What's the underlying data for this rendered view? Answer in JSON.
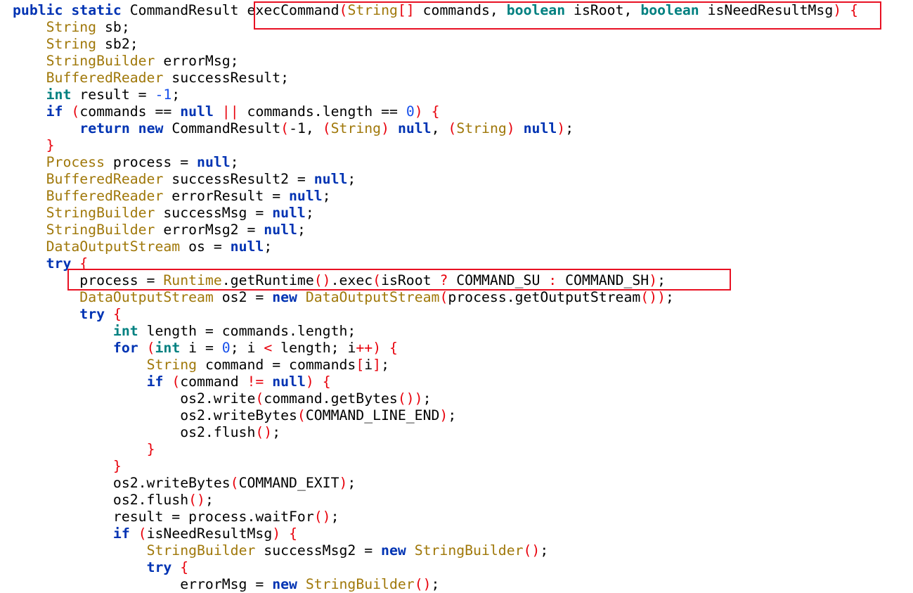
{
  "colors": {
    "background": "#ffffff",
    "keyword": "#0033b3",
    "keyword_alt": "#008080",
    "type": "#a0780a",
    "number": "#1750eb",
    "punctuation": "#e8000b",
    "plain": "#000000",
    "highlight_box": "#e81123"
  },
  "highlights": [
    {
      "name": "highlight-box-method-signature",
      "target": "line 1"
    },
    {
      "name": "highlight-box-runtime-exec",
      "target": "line 17"
    }
  ],
  "code_lines": [
    {
      "indent": "",
      "tokens": [
        [
          "kw",
          "public"
        ],
        [
          "plain",
          " "
        ],
        [
          "kw",
          "static"
        ],
        [
          "plain",
          " CommandResult "
        ],
        [
          "plain",
          "execCommand"
        ],
        [
          "punc",
          "("
        ],
        [
          "type",
          "String"
        ],
        [
          "punc",
          "[]"
        ],
        [
          "plain",
          " commands, "
        ],
        [
          "kw2",
          "boolean"
        ],
        [
          "plain",
          " isRoot, "
        ],
        [
          "kw2",
          "boolean"
        ],
        [
          "plain",
          " isNeedResultMsg"
        ],
        [
          "punc",
          ")"
        ],
        [
          "plain",
          " "
        ],
        [
          "punc",
          "{"
        ]
      ]
    },
    {
      "indent": "    ",
      "tokens": [
        [
          "type",
          "String"
        ],
        [
          "plain",
          " sb;"
        ]
      ]
    },
    {
      "indent": "    ",
      "tokens": [
        [
          "type",
          "String"
        ],
        [
          "plain",
          " sb2;"
        ]
      ]
    },
    {
      "indent": "    ",
      "tokens": [
        [
          "type",
          "StringBuilder"
        ],
        [
          "plain",
          " errorMsg;"
        ]
      ]
    },
    {
      "indent": "    ",
      "tokens": [
        [
          "type",
          "BufferedReader"
        ],
        [
          "plain",
          " successResult;"
        ]
      ]
    },
    {
      "indent": "    ",
      "tokens": [
        [
          "kw2",
          "int"
        ],
        [
          "plain",
          " result = "
        ],
        [
          "num",
          "-1"
        ],
        [
          "plain",
          ";"
        ]
      ]
    },
    {
      "indent": "    ",
      "tokens": [
        [
          "kw",
          "if"
        ],
        [
          "plain",
          " "
        ],
        [
          "punc",
          "("
        ],
        [
          "plain",
          "commands == "
        ],
        [
          "kw",
          "null"
        ],
        [
          "plain",
          " "
        ],
        [
          "punc",
          "||"
        ],
        [
          "plain",
          " commands.length == "
        ],
        [
          "num",
          "0"
        ],
        [
          "punc",
          ")"
        ],
        [
          "plain",
          " "
        ],
        [
          "punc",
          "{"
        ]
      ]
    },
    {
      "indent": "        ",
      "tokens": [
        [
          "kw",
          "return"
        ],
        [
          "plain",
          " "
        ],
        [
          "kw",
          "new"
        ],
        [
          "plain",
          " CommandResult"
        ],
        [
          "punc",
          "("
        ],
        [
          "plain",
          "-1, "
        ],
        [
          "punc",
          "("
        ],
        [
          "type",
          "String"
        ],
        [
          "punc",
          ")"
        ],
        [
          "plain",
          " "
        ],
        [
          "kw",
          "null"
        ],
        [
          "plain",
          ", "
        ],
        [
          "punc",
          "("
        ],
        [
          "type",
          "String"
        ],
        [
          "punc",
          ")"
        ],
        [
          "plain",
          " "
        ],
        [
          "kw",
          "null"
        ],
        [
          "punc",
          ")"
        ],
        [
          "plain",
          ";"
        ]
      ]
    },
    {
      "indent": "    ",
      "tokens": [
        [
          "punc",
          "}"
        ]
      ]
    },
    {
      "indent": "    ",
      "tokens": [
        [
          "type",
          "Process"
        ],
        [
          "plain",
          " process = "
        ],
        [
          "kw",
          "null"
        ],
        [
          "plain",
          ";"
        ]
      ]
    },
    {
      "indent": "    ",
      "tokens": [
        [
          "type",
          "BufferedReader"
        ],
        [
          "plain",
          " successResult2 = "
        ],
        [
          "kw",
          "null"
        ],
        [
          "plain",
          ";"
        ]
      ]
    },
    {
      "indent": "    ",
      "tokens": [
        [
          "type",
          "BufferedReader"
        ],
        [
          "plain",
          " errorResult = "
        ],
        [
          "kw",
          "null"
        ],
        [
          "plain",
          ";"
        ]
      ]
    },
    {
      "indent": "    ",
      "tokens": [
        [
          "type",
          "StringBuilder"
        ],
        [
          "plain",
          " successMsg = "
        ],
        [
          "kw",
          "null"
        ],
        [
          "plain",
          ";"
        ]
      ]
    },
    {
      "indent": "    ",
      "tokens": [
        [
          "type",
          "StringBuilder"
        ],
        [
          "plain",
          " errorMsg2 = "
        ],
        [
          "kw",
          "null"
        ],
        [
          "plain",
          ";"
        ]
      ]
    },
    {
      "indent": "    ",
      "tokens": [
        [
          "type",
          "DataOutputStream"
        ],
        [
          "plain",
          " os = "
        ],
        [
          "kw",
          "null"
        ],
        [
          "plain",
          ";"
        ]
      ]
    },
    {
      "indent": "    ",
      "tokens": [
        [
          "kw",
          "try"
        ],
        [
          "plain",
          " "
        ],
        [
          "punc",
          "{"
        ]
      ]
    },
    {
      "indent": "        ",
      "tokens": [
        [
          "plain",
          "process = "
        ],
        [
          "type",
          "Runtime"
        ],
        [
          "plain",
          ".getRuntime"
        ],
        [
          "punc",
          "()"
        ],
        [
          "plain",
          ".exec"
        ],
        [
          "punc",
          "("
        ],
        [
          "plain",
          "isRoot "
        ],
        [
          "punc",
          "?"
        ],
        [
          "plain",
          " COMMAND_SU "
        ],
        [
          "punc",
          ":"
        ],
        [
          "plain",
          " COMMAND_SH"
        ],
        [
          "punc",
          ")"
        ],
        [
          "plain",
          ";"
        ]
      ]
    },
    {
      "indent": "        ",
      "tokens": [
        [
          "type",
          "DataOutputStream"
        ],
        [
          "plain",
          " os2 = "
        ],
        [
          "kw",
          "new"
        ],
        [
          "plain",
          " "
        ],
        [
          "type",
          "DataOutputStream"
        ],
        [
          "punc",
          "("
        ],
        [
          "plain",
          "process.getOutputStream"
        ],
        [
          "punc",
          "())"
        ],
        [
          "plain",
          ";"
        ]
      ]
    },
    {
      "indent": "        ",
      "tokens": [
        [
          "kw",
          "try"
        ],
        [
          "plain",
          " "
        ],
        [
          "punc",
          "{"
        ]
      ]
    },
    {
      "indent": "            ",
      "tokens": [
        [
          "kw2",
          "int"
        ],
        [
          "plain",
          " length = commands.length;"
        ]
      ]
    },
    {
      "indent": "            ",
      "tokens": [
        [
          "kw",
          "for"
        ],
        [
          "plain",
          " "
        ],
        [
          "punc",
          "("
        ],
        [
          "kw2",
          "int"
        ],
        [
          "plain",
          " i = "
        ],
        [
          "num",
          "0"
        ],
        [
          "plain",
          "; i "
        ],
        [
          "punc",
          "<"
        ],
        [
          "plain",
          " length; i"
        ],
        [
          "punc",
          "++"
        ],
        [
          "punc",
          ")"
        ],
        [
          "plain",
          " "
        ],
        [
          "punc",
          "{"
        ]
      ]
    },
    {
      "indent": "                ",
      "tokens": [
        [
          "type",
          "String"
        ],
        [
          "plain",
          " command = commands"
        ],
        [
          "punc",
          "["
        ],
        [
          "plain",
          "i"
        ],
        [
          "punc",
          "]"
        ],
        [
          "plain",
          ";"
        ]
      ]
    },
    {
      "indent": "                ",
      "tokens": [
        [
          "kw",
          "if"
        ],
        [
          "plain",
          " "
        ],
        [
          "punc",
          "("
        ],
        [
          "plain",
          "command "
        ],
        [
          "punc",
          "!="
        ],
        [
          "plain",
          " "
        ],
        [
          "kw",
          "null"
        ],
        [
          "punc",
          ")"
        ],
        [
          "plain",
          " "
        ],
        [
          "punc",
          "{"
        ]
      ]
    },
    {
      "indent": "                    ",
      "tokens": [
        [
          "plain",
          "os2.write"
        ],
        [
          "punc",
          "("
        ],
        [
          "plain",
          "command.getBytes"
        ],
        [
          "punc",
          "())"
        ],
        [
          "plain",
          ";"
        ]
      ]
    },
    {
      "indent": "                    ",
      "tokens": [
        [
          "plain",
          "os2.writeBytes"
        ],
        [
          "punc",
          "("
        ],
        [
          "plain",
          "COMMAND_LINE_END"
        ],
        [
          "punc",
          ")"
        ],
        [
          "plain",
          ";"
        ]
      ]
    },
    {
      "indent": "                    ",
      "tokens": [
        [
          "plain",
          "os2.flush"
        ],
        [
          "punc",
          "()"
        ],
        [
          "plain",
          ";"
        ]
      ]
    },
    {
      "indent": "                ",
      "tokens": [
        [
          "punc",
          "}"
        ]
      ]
    },
    {
      "indent": "            ",
      "tokens": [
        [
          "punc",
          "}"
        ]
      ]
    },
    {
      "indent": "            ",
      "tokens": [
        [
          "plain",
          "os2.writeBytes"
        ],
        [
          "punc",
          "("
        ],
        [
          "plain",
          "COMMAND_EXIT"
        ],
        [
          "punc",
          ")"
        ],
        [
          "plain",
          ";"
        ]
      ]
    },
    {
      "indent": "            ",
      "tokens": [
        [
          "plain",
          "os2.flush"
        ],
        [
          "punc",
          "()"
        ],
        [
          "plain",
          ";"
        ]
      ]
    },
    {
      "indent": "            ",
      "tokens": [
        [
          "plain",
          "result = process.waitFor"
        ],
        [
          "punc",
          "()"
        ],
        [
          "plain",
          ";"
        ]
      ]
    },
    {
      "indent": "            ",
      "tokens": [
        [
          "kw",
          "if"
        ],
        [
          "plain",
          " "
        ],
        [
          "punc",
          "("
        ],
        [
          "plain",
          "isNeedResultMsg"
        ],
        [
          "punc",
          ")"
        ],
        [
          "plain",
          " "
        ],
        [
          "punc",
          "{"
        ]
      ]
    },
    {
      "indent": "                ",
      "tokens": [
        [
          "type",
          "StringBuilder"
        ],
        [
          "plain",
          " successMsg2 = "
        ],
        [
          "kw",
          "new"
        ],
        [
          "plain",
          " "
        ],
        [
          "type",
          "StringBuilder"
        ],
        [
          "punc",
          "()"
        ],
        [
          "plain",
          ";"
        ]
      ]
    },
    {
      "indent": "                ",
      "tokens": [
        [
          "kw",
          "try"
        ],
        [
          "plain",
          " "
        ],
        [
          "punc",
          "{"
        ]
      ]
    },
    {
      "indent": "                    ",
      "tokens": [
        [
          "plain",
          "errorMsg = "
        ],
        [
          "kw",
          "new"
        ],
        [
          "plain",
          " "
        ],
        [
          "type",
          "StringBuilder"
        ],
        [
          "punc",
          "()"
        ],
        [
          "plain",
          ";"
        ]
      ]
    }
  ]
}
